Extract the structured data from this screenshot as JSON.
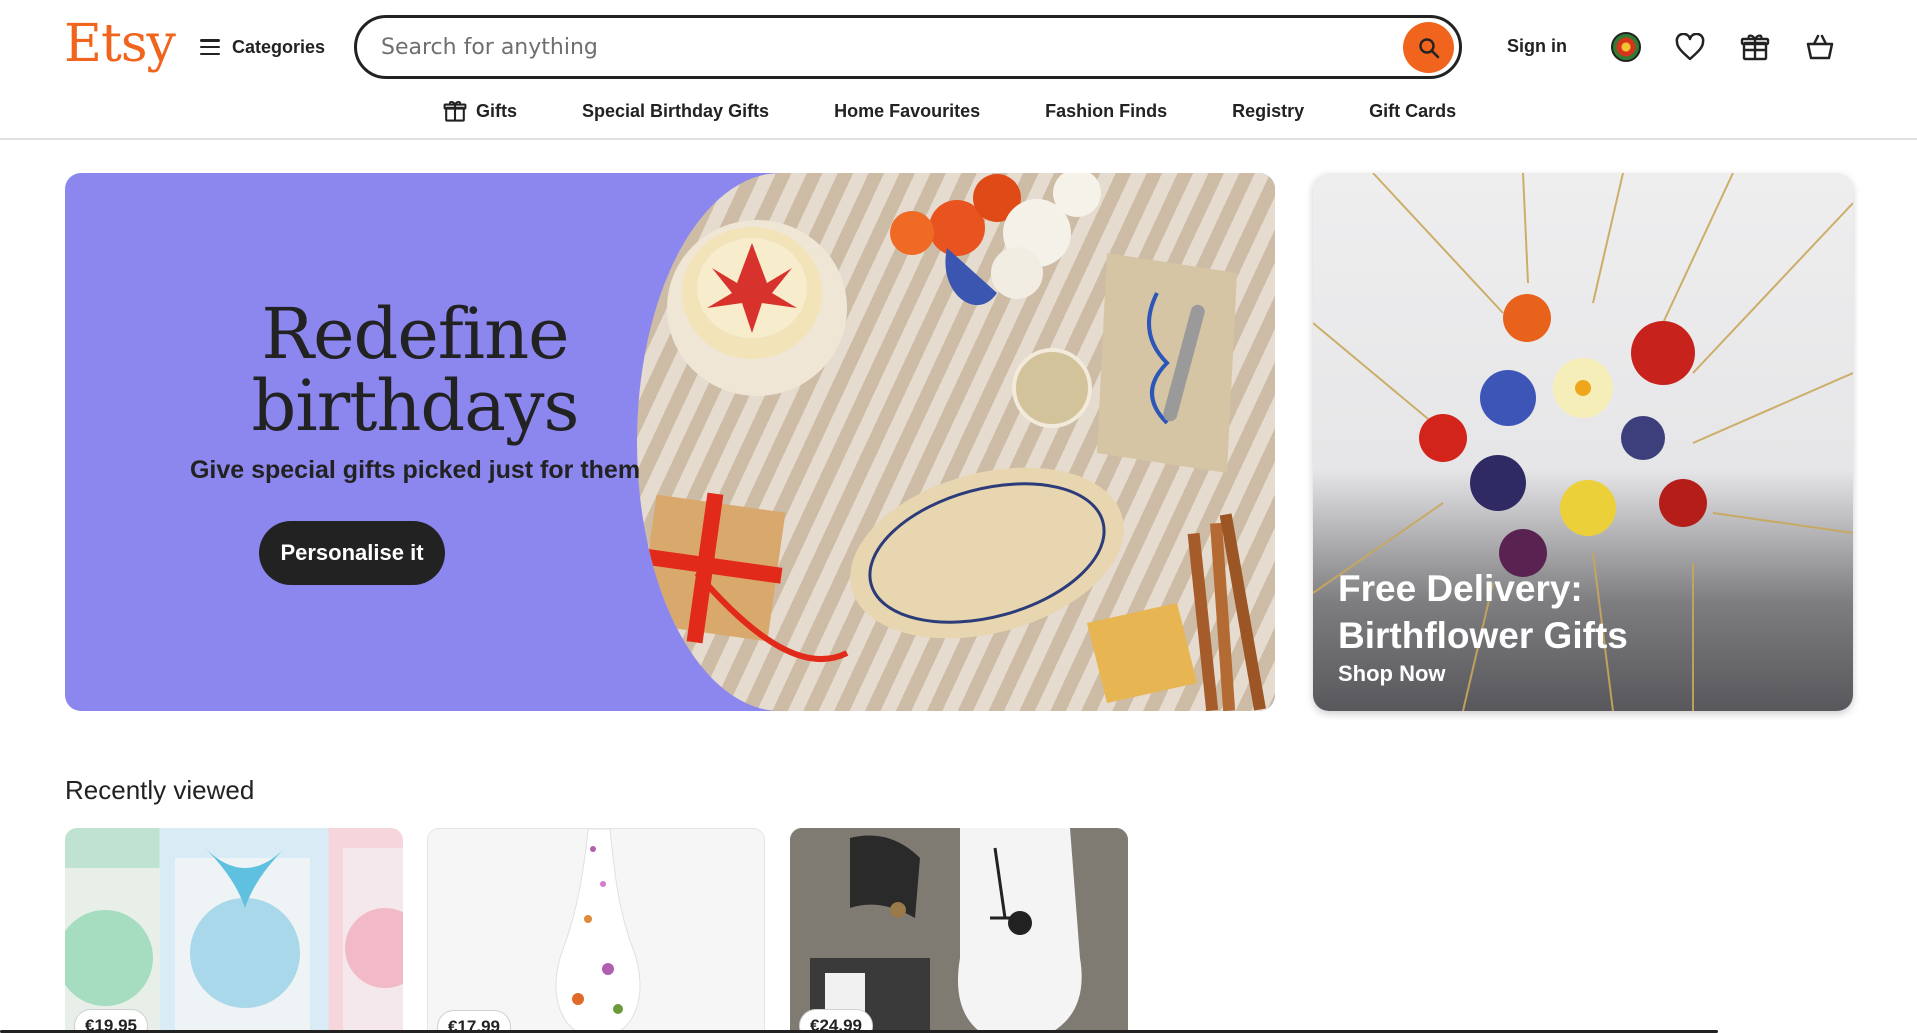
{
  "header": {
    "logo": "Etsy",
    "categories_label": "Categories",
    "search_placeholder": "Search for anything",
    "sign_in": "Sign in"
  },
  "subnav": {
    "items": [
      {
        "label": "Gifts",
        "icon": "gift-icon"
      },
      {
        "label": "Special Birthday Gifts"
      },
      {
        "label": "Home Favourites"
      },
      {
        "label": "Fashion Finds"
      },
      {
        "label": "Registry"
      },
      {
        "label": "Gift Cards"
      }
    ]
  },
  "hero": {
    "title_line1": "Redefine",
    "title_line2": "birthdays",
    "subtitle": "Give special gifts picked just for them",
    "button": "Personalise it",
    "background_color": "#8c87ef"
  },
  "promo": {
    "title_line1": "Free Delivery:",
    "title_line2": "Birthflower Gifts",
    "link": "Shop Now"
  },
  "recently_viewed": {
    "title": "Recently viewed",
    "items": [
      {
        "price": "€19.95"
      },
      {
        "price": "€17.99"
      },
      {
        "price": "€24.99"
      }
    ]
  },
  "colors": {
    "brand": "#f1641e",
    "text": "#222222"
  }
}
